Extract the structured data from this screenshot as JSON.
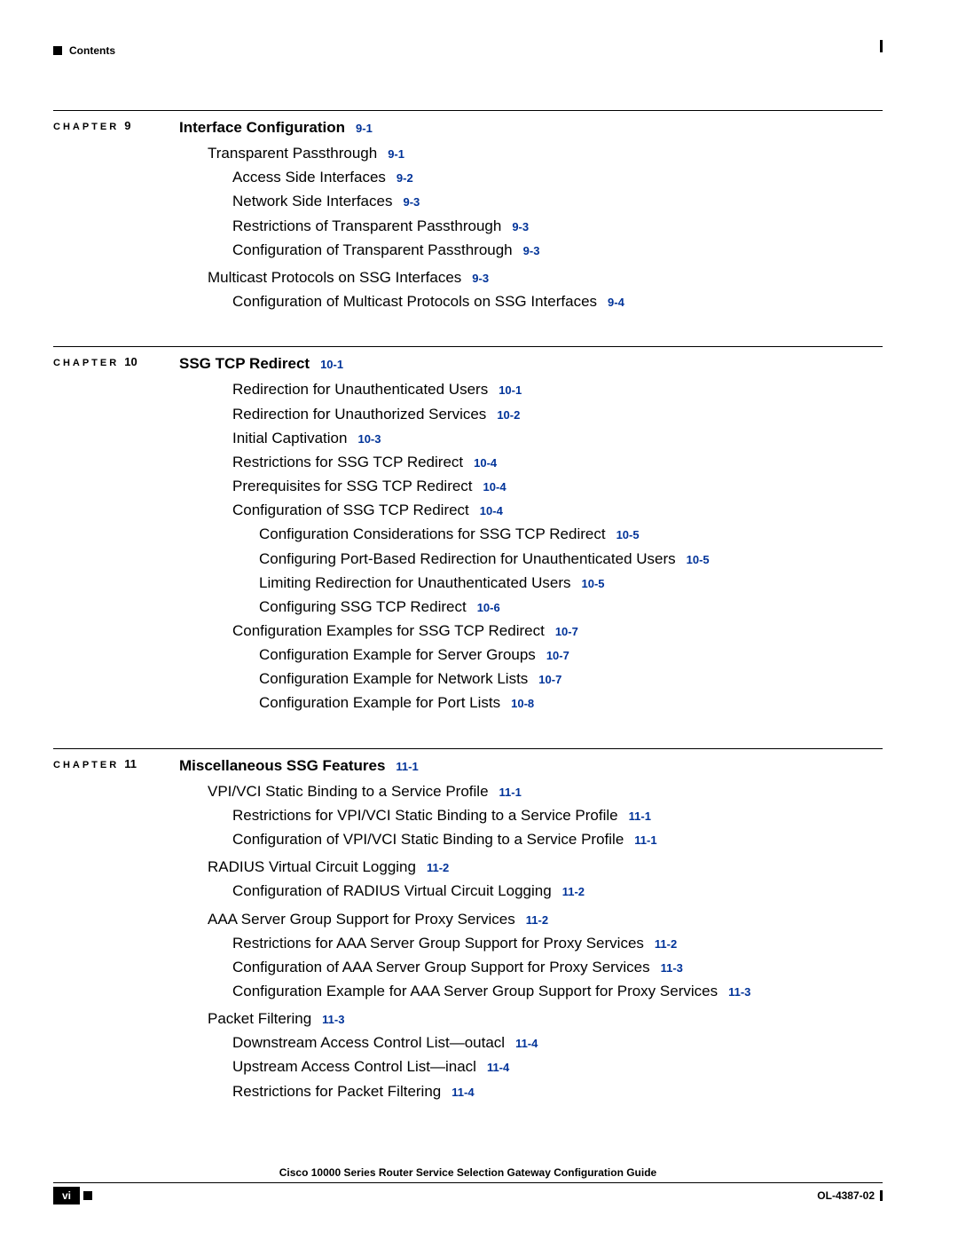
{
  "header": {
    "contents_label": "Contents"
  },
  "chapters": [
    {
      "label": "CHAPTER",
      "num": "9",
      "title": "Interface Configuration",
      "title_pg": "9-1",
      "entries": [
        {
          "text": "Transparent Passthrough",
          "pg": "9-1",
          "indent": 1
        },
        {
          "text": "Access Side Interfaces",
          "pg": "9-2",
          "indent": 2
        },
        {
          "text": "Network Side Interfaces",
          "pg": "9-3",
          "indent": 2
        },
        {
          "text": "Restrictions of Transparent Passthrough",
          "pg": "9-3",
          "indent": 2
        },
        {
          "text": "Configuration of Transparent Passthrough",
          "pg": "9-3",
          "indent": 2
        },
        {
          "text": "Multicast Protocols on SSG Interfaces",
          "pg": "9-3",
          "indent": 1,
          "gap": true
        },
        {
          "text": "Configuration of Multicast Protocols on SSG Interfaces",
          "pg": "9-4",
          "indent": 2
        }
      ]
    },
    {
      "label": "CHAPTER",
      "num": "10",
      "title": "SSG TCP Redirect",
      "title_pg": "10-1",
      "entries": [
        {
          "text": "Redirection for Unauthenticated Users",
          "pg": "10-1",
          "indent": 2
        },
        {
          "text": "Redirection for Unauthorized Services",
          "pg": "10-2",
          "indent": 2
        },
        {
          "text": "Initial Captivation",
          "pg": "10-3",
          "indent": 2
        },
        {
          "text": "Restrictions for SSG TCP Redirect",
          "pg": "10-4",
          "indent": 2
        },
        {
          "text": "Prerequisites for SSG TCP Redirect",
          "pg": "10-4",
          "indent": 2
        },
        {
          "text": "Configuration of SSG TCP Redirect",
          "pg": "10-4",
          "indent": 2
        },
        {
          "text": "Configuration Considerations for SSG TCP Redirect",
          "pg": "10-5",
          "indent": 3
        },
        {
          "text": "Configuring Port-Based Redirection for Unauthenticated Users",
          "pg": "10-5",
          "indent": 3
        },
        {
          "text": "Limiting Redirection for Unauthenticated Users",
          "pg": "10-5",
          "indent": 3
        },
        {
          "text": "Configuring SSG TCP Redirect",
          "pg": "10-6",
          "indent": 3
        },
        {
          "text": "Configuration Examples for SSG TCP Redirect",
          "pg": "10-7",
          "indent": 2
        },
        {
          "text": "Configuration Example for Server Groups",
          "pg": "10-7",
          "indent": 3
        },
        {
          "text": "Configuration Example for Network Lists",
          "pg": "10-7",
          "indent": 3
        },
        {
          "text": "Configuration Example for Port Lists",
          "pg": "10-8",
          "indent": 3
        }
      ]
    },
    {
      "label": "CHAPTER",
      "num": "11",
      "title": "Miscellaneous SSG Features",
      "title_pg": "11-1",
      "entries": [
        {
          "text": "VPI/VCI Static Binding to a Service Profile",
          "pg": "11-1",
          "indent": 1
        },
        {
          "text": "Restrictions for VPI/VCI Static Binding to a Service Profile",
          "pg": "11-1",
          "indent": 2
        },
        {
          "text": "Configuration of VPI/VCI Static Binding to a Service Profile",
          "pg": "11-1",
          "indent": 2
        },
        {
          "text": "RADIUS Virtual Circuit Logging",
          "pg": "11-2",
          "indent": 1,
          "gap": true
        },
        {
          "text": "Configuration of RADIUS Virtual Circuit Logging",
          "pg": "11-2",
          "indent": 2
        },
        {
          "text": "AAA Server Group Support for Proxy Services",
          "pg": "11-2",
          "indent": 1,
          "gap": true
        },
        {
          "text": "Restrictions for AAA Server Group Support for Proxy Services",
          "pg": "11-2",
          "indent": 2
        },
        {
          "text": "Configuration of AAA Server Group Support for Proxy Services",
          "pg": "11-3",
          "indent": 2
        },
        {
          "text": "Configuration Example for AAA Server Group Support for Proxy Services",
          "pg": "11-3",
          "indent": 2
        },
        {
          "text": "Packet Filtering",
          "pg": "11-3",
          "indent": 1,
          "gap": true
        },
        {
          "text": "Downstream Access Control List—outacl",
          "pg": "11-4",
          "indent": 2
        },
        {
          "text": "Upstream Access Control List—inacl",
          "pg": "11-4",
          "indent": 2
        },
        {
          "text": "Restrictions for Packet Filtering",
          "pg": "11-4",
          "indent": 2
        }
      ]
    }
  ],
  "footer": {
    "title": "Cisco 10000 Series Router Service Selection Gateway Configuration Guide",
    "page_num": "vi",
    "doc_code": "OL-4387-02"
  }
}
